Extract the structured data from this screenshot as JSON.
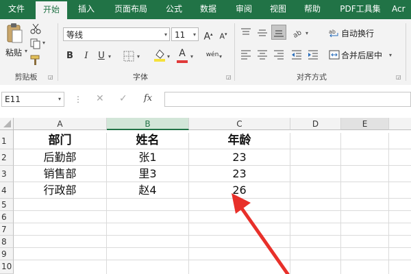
{
  "ribbon_tabs": [
    "文件",
    "开始",
    "插入",
    "页面布局",
    "公式",
    "数据",
    "审阅",
    "视图",
    "帮助",
    "PDF工具集",
    "Acr"
  ],
  "ribbon": {
    "clipboard": {
      "paste_label": "粘贴",
      "group_label": "剪贴板"
    },
    "font": {
      "font_name": "等线",
      "font_size": "11",
      "grow_label": "A",
      "shrink_label": "A",
      "bold_label": "B",
      "italic_label": "I",
      "underline_label": "U",
      "font_color_label": "A",
      "phonetic_label": "wén",
      "group_label": "字体"
    },
    "alignment": {
      "wrap_text_label": "自动换行",
      "merge_center_label": "合并后居中",
      "group_label": "对齐方式"
    }
  },
  "formula_bar": {
    "name_box": "E11",
    "fx_label": "fx",
    "formula": ""
  },
  "grid": {
    "columns": [
      "A",
      "B",
      "C",
      "D",
      "E"
    ],
    "selected_column": "E",
    "rows": [
      "1",
      "2",
      "3",
      "4",
      "5",
      "6",
      "7",
      "8",
      "9",
      "10"
    ],
    "cells": [
      [
        "部门",
        "姓名",
        "年龄"
      ],
      [
        "后勤部",
        "张1",
        "23"
      ],
      [
        "销售部",
        "里3",
        "23"
      ],
      [
        "行政部",
        "赵4",
        "26"
      ]
    ]
  },
  "colors": {
    "accent": "#217346",
    "arrow": "#e8302a",
    "font_color_bar": "#e03a3a",
    "highlight_bar": "#f5e13a"
  }
}
